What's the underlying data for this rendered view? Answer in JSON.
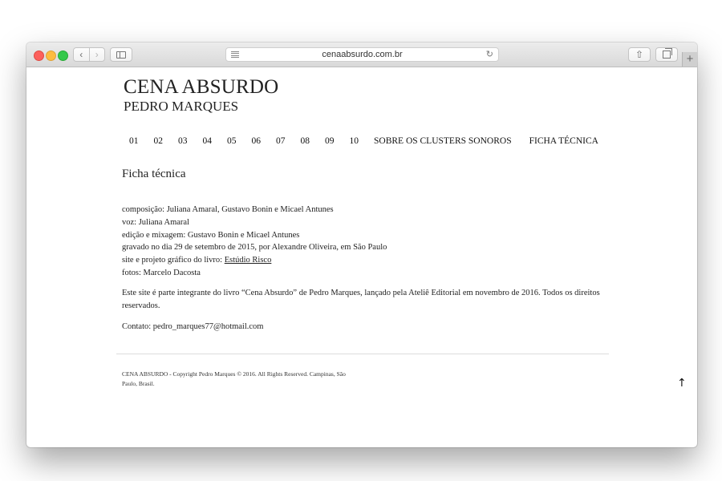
{
  "browser": {
    "url": "cenaabsurdo.com.br",
    "back_glyph": "‹",
    "forward_glyph": "›",
    "reload_glyph": "↻",
    "share_glyph": "⇧",
    "new_tab_glyph": "+"
  },
  "site": {
    "title": "CENA ABSURDO",
    "subtitle": "PEDRO MARQUES"
  },
  "menu": {
    "items": [
      "01",
      "02",
      "03",
      "04",
      "05",
      "06",
      "07",
      "08",
      "09",
      "10",
      "SOBRE OS CLUSTERS SONOROS",
      "FICHA TÉCNICA"
    ]
  },
  "page": {
    "heading": "Ficha técnica",
    "credits": [
      "composição: Juliana Amaral, Gustavo Bonin e Micael Antunes",
      "voz: Juliana Amaral",
      "edição e mixagem: Gustavo Bonin e Micael Antunes",
      "gravado no dia 29 de setembro de 2015, por Alexandre Oliveira, em São Paulo"
    ],
    "site_credit_prefix": "site e projeto gráfico do livro: ",
    "site_credit_link": "Estúdio Risco",
    "photos": "fotos: Marcelo Dacosta",
    "about": "Este site é parte integrante do livro “Cena Absurdo” de Pedro Marques, lançado pela Ateliê Editorial em novembro de 2016. Todos os direitos reservados.",
    "contact": "Contato: pedro_marques77@hotmail.com"
  },
  "footer": {
    "text": "CENA ABSURDO - Copyright Pedro Marques © 2016. All Rights Reserved. Campinas, São Paulo, Brasil.",
    "back_to_top": "↑"
  }
}
